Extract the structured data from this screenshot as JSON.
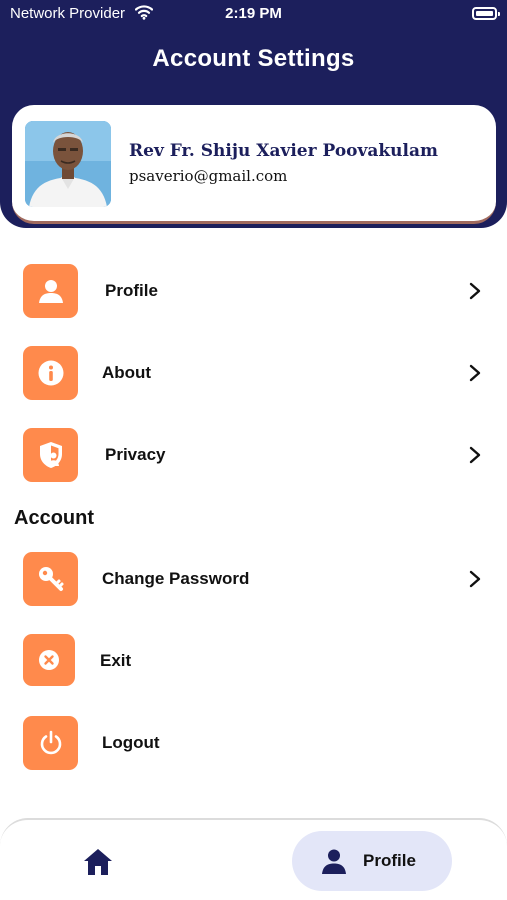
{
  "status_bar": {
    "carrier": "Network Provider",
    "time": "2:19 PM"
  },
  "header": {
    "title": "Account Settings"
  },
  "profile": {
    "name": "Rev Fr. Shiju Xavier Poovakulam",
    "email": "psaverio@gmail.com"
  },
  "menu": [
    {
      "label": "Profile",
      "icon": "person-icon"
    },
    {
      "label": "About",
      "icon": "info-icon"
    },
    {
      "label": "Privacy",
      "icon": "shield-user-icon"
    }
  ],
  "account_section": {
    "title": "Account",
    "items": [
      {
        "label": "Change Password",
        "icon": "key-icon"
      },
      {
        "label": "Exit",
        "icon": "close-circle-icon"
      },
      {
        "label": "Logout",
        "icon": "power-icon"
      }
    ]
  },
  "bottom_nav": {
    "home_icon": "home-icon",
    "profile_label": "Profile"
  },
  "colors": {
    "header": "#1c1f5c",
    "accent": "#ff8a4c",
    "active_tab": "#e3e6f8"
  }
}
